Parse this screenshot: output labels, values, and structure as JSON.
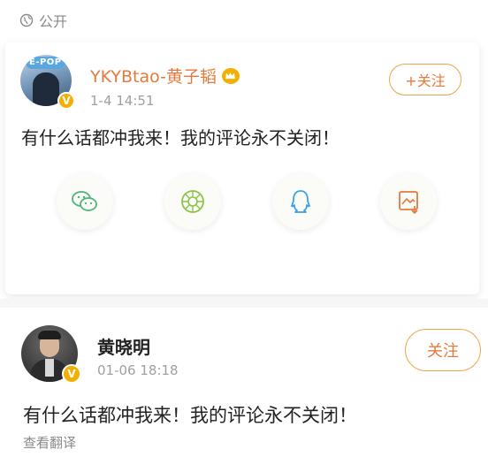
{
  "visibility": {
    "label": "公开",
    "icon": "globe-icon"
  },
  "post1": {
    "author": "YKYBtao-黄子韬",
    "avatar_logo_text": "E-POP",
    "verified_icon": "verified-badge-icon",
    "member_icon": "crown-icon",
    "timestamp": "1-4 14:51",
    "follow_label": "+关注",
    "content": "有什么话都冲我来！我的评论永不关闭！",
    "share": [
      {
        "name": "wechat",
        "icon": "wechat-icon"
      },
      {
        "name": "moments",
        "icon": "moments-icon"
      },
      {
        "name": "qq",
        "icon": "qq-icon"
      },
      {
        "name": "save-image",
        "icon": "save-image-icon"
      }
    ]
  },
  "post2": {
    "author": "黄晓明",
    "verified_icon": "verified-badge-icon",
    "timestamp": "01-06 18:18",
    "follow_label": "关注",
    "content": "有什么话都冲我来！我的评论永不关闭！",
    "translate_label": "查看翻译"
  },
  "colors": {
    "accent": "#e5793c",
    "follow_border": "#f0a44a",
    "muted": "#a0a0a0",
    "badge": "#f4b000"
  }
}
